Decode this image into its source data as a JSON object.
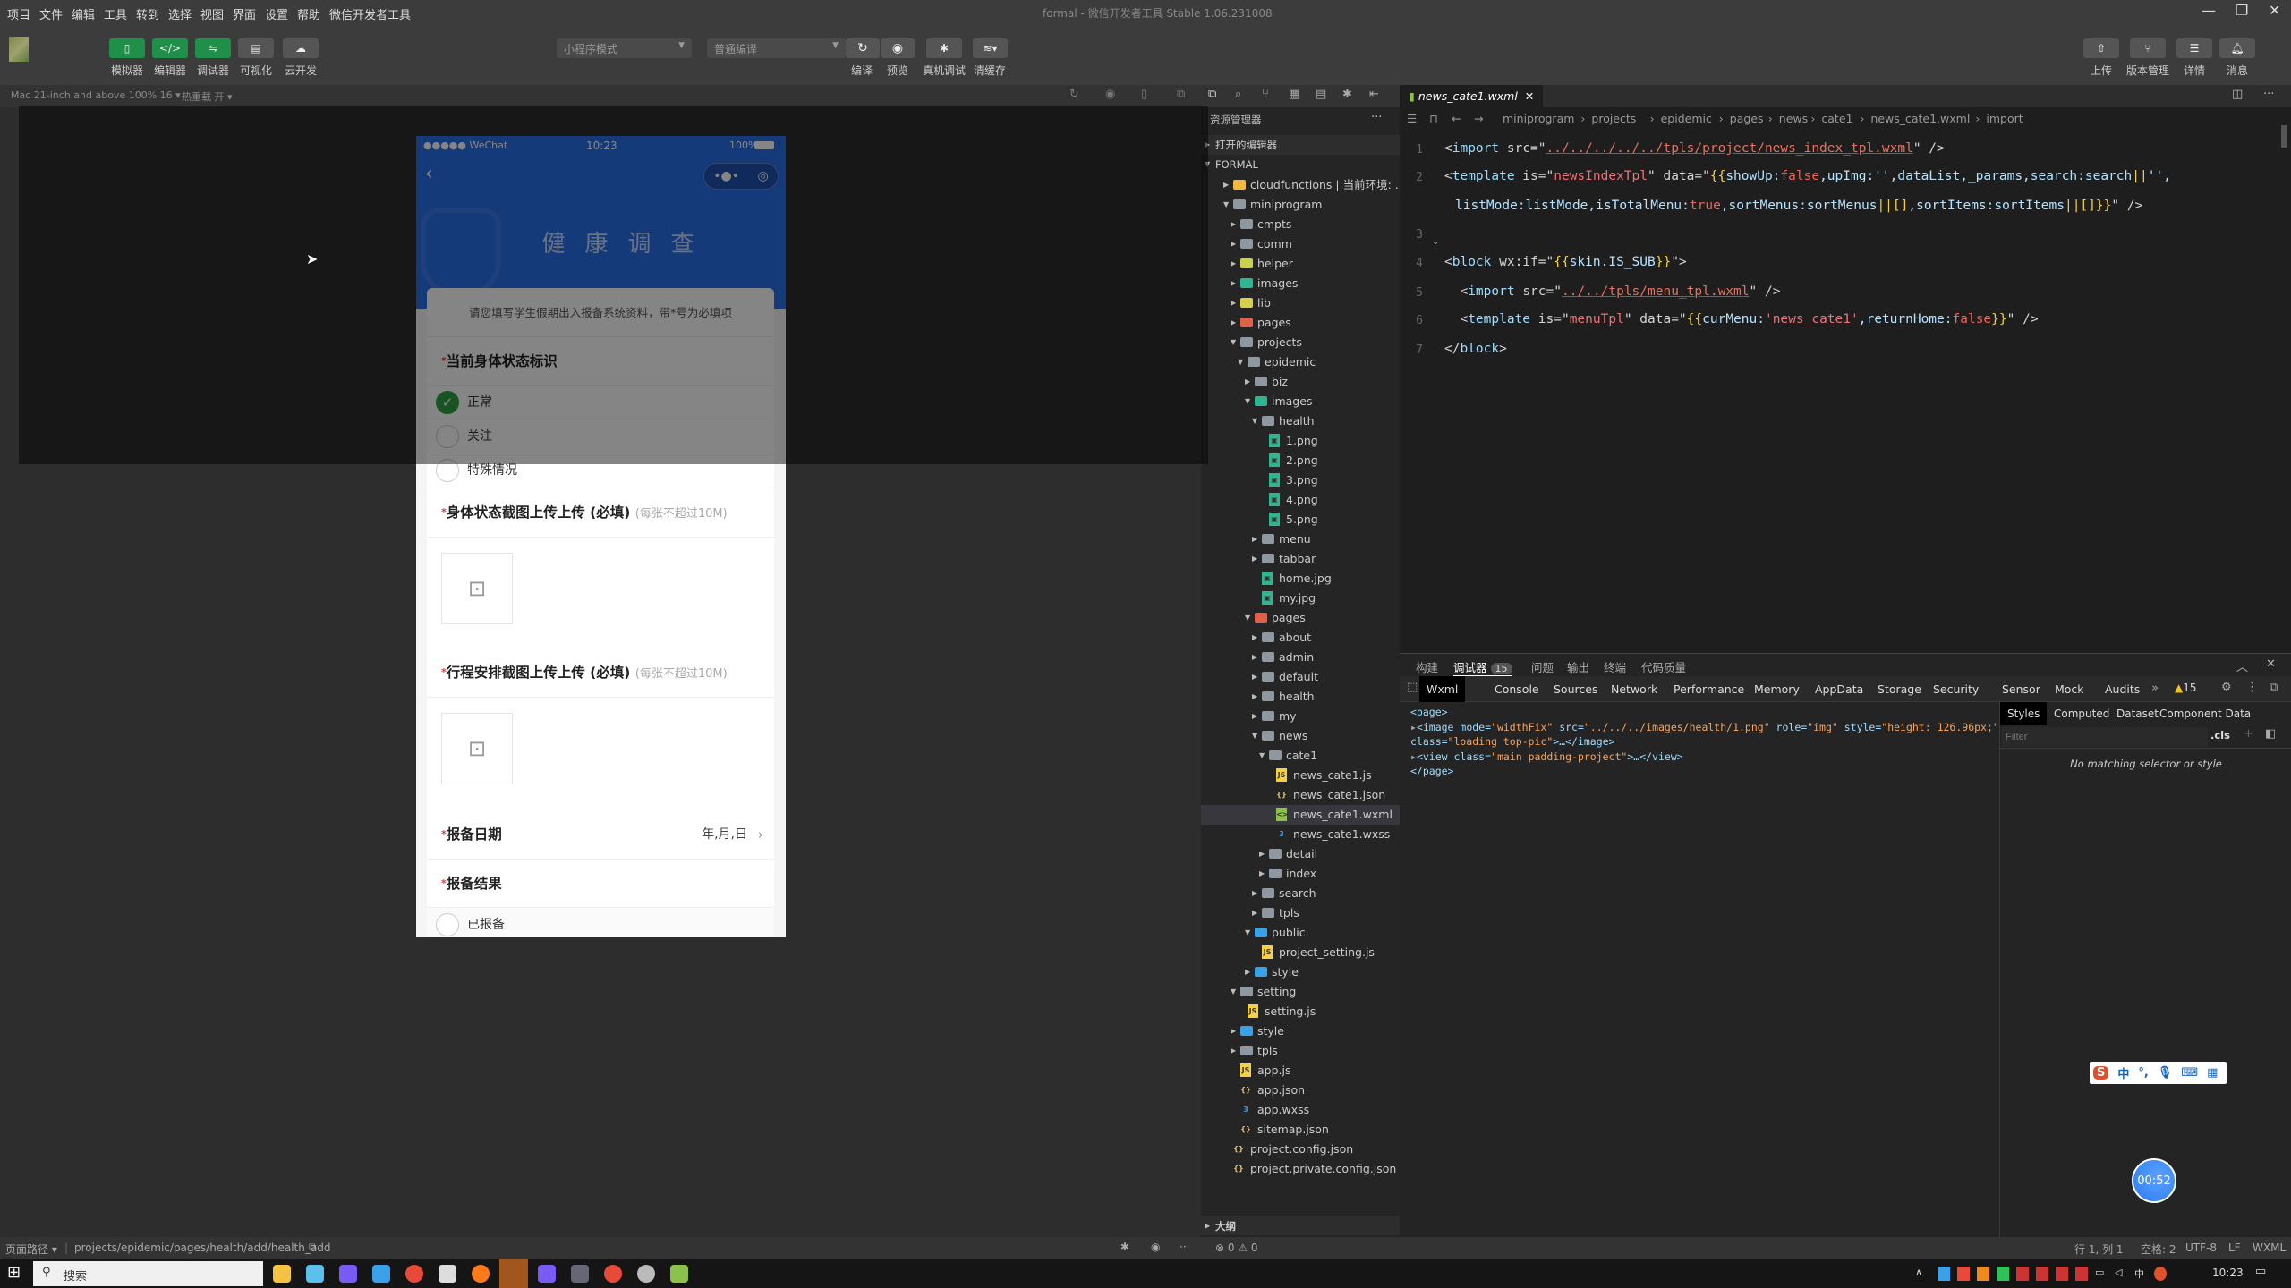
{
  "window": {
    "title": "formal - 微信开发者工具 Stable 1.06.231008",
    "menu": [
      "项目",
      "文件",
      "编辑",
      "工具",
      "转到",
      "选择",
      "视图",
      "界面",
      "设置",
      "帮助",
      "微信开发者工具"
    ]
  },
  "toolbar": {
    "left_buttons": [
      "模拟器",
      "编辑器",
      "调试器",
      "可视化",
      "云开发"
    ],
    "mode_select": "小程序模式",
    "compile_select": "普通编译",
    "actions": [
      "编译",
      "预览",
      "真机调试",
      "清缓存"
    ],
    "right_buttons": [
      "上传",
      "版本管理",
      "详情",
      "消息"
    ]
  },
  "simulator": {
    "device": "Mac 21-inch and above 100% 16 ▾",
    "hot_reload": "热重载 开 ▾",
    "phone": {
      "carrier": "●●●●● WeChat",
      "time": "10:23",
      "battery": "100%",
      "title": "健康调查",
      "intro": "请您填写学生假期出入报备系统资料，带*号为必填项",
      "q1": "当前身体状态标识",
      "options": [
        "正常",
        "关注",
        "特殊情况"
      ],
      "selected_option": "正常",
      "q2": "身体状态截图上传上传 (必填)",
      "q3": "行程安排截图上传上传 (必填)",
      "upload_hint": "(每张不超过10M)",
      "q4": "报备日期",
      "date_placeholder": "年,月,日",
      "q5": "报备结果",
      "result_option": "已报备",
      "required_mark": "*"
    }
  },
  "explorer": {
    "title": "资源管理器",
    "more": "···",
    "open_editors": "打开的编辑器",
    "root": "FORMAL",
    "outline": "大纲",
    "tree": [
      {
        "label": "cloudfunctions | 当前环境: ...",
        "depth": 1,
        "kind": "folder-cloud",
        "open": false
      },
      {
        "label": "miniprogram",
        "depth": 1,
        "kind": "folder",
        "open": true
      },
      {
        "label": "cmpts",
        "depth": 2,
        "kind": "folder",
        "open": false
      },
      {
        "label": "comm",
        "depth": 2,
        "kind": "folder",
        "open": false
      },
      {
        "label": "helper",
        "depth": 2,
        "kind": "folder-helper",
        "open": false
      },
      {
        "label": "images",
        "depth": 2,
        "kind": "folder-images",
        "open": false
      },
      {
        "label": "lib",
        "depth": 2,
        "kind": "folder-lib",
        "open": false
      },
      {
        "label": "pages",
        "depth": 2,
        "kind": "folder-pages",
        "open": false
      },
      {
        "label": "projects",
        "depth": 2,
        "kind": "folder",
        "open": true
      },
      {
        "label": "epidemic",
        "depth": 3,
        "kind": "folder",
        "open": true
      },
      {
        "label": "biz",
        "depth": 4,
        "kind": "folder",
        "open": false
      },
      {
        "label": "images",
        "depth": 4,
        "kind": "folder-images",
        "open": true
      },
      {
        "label": "health",
        "depth": 5,
        "kind": "folder",
        "open": true
      },
      {
        "label": "1.png",
        "depth": 6,
        "kind": "image"
      },
      {
        "label": "2.png",
        "depth": 6,
        "kind": "image"
      },
      {
        "label": "3.png",
        "depth": 6,
        "kind": "image"
      },
      {
        "label": "4.png",
        "depth": 6,
        "kind": "image"
      },
      {
        "label": "5.png",
        "depth": 6,
        "kind": "image"
      },
      {
        "label": "menu",
        "depth": 5,
        "kind": "folder",
        "open": false
      },
      {
        "label": "tabbar",
        "depth": 5,
        "kind": "folder",
        "open": false
      },
      {
        "label": "home.jpg",
        "depth": 5,
        "kind": "image"
      },
      {
        "label": "my.jpg",
        "depth": 5,
        "kind": "image"
      },
      {
        "label": "pages",
        "depth": 4,
        "kind": "folder-pages",
        "open": true
      },
      {
        "label": "about",
        "depth": 5,
        "kind": "folder",
        "open": false
      },
      {
        "label": "admin",
        "depth": 5,
        "kind": "folder",
        "open": false
      },
      {
        "label": "default",
        "depth": 5,
        "kind": "folder",
        "open": false
      },
      {
        "label": "health",
        "depth": 5,
        "kind": "folder",
        "open": false
      },
      {
        "label": "my",
        "depth": 5,
        "kind": "folder",
        "open": false
      },
      {
        "label": "news",
        "depth": 5,
        "kind": "folder",
        "open": true
      },
      {
        "label": "cate1",
        "depth": 6,
        "kind": "folder",
        "open": true
      },
      {
        "label": "news_cate1.js",
        "depth": 7,
        "kind": "js"
      },
      {
        "label": "news_cate1.json",
        "depth": 7,
        "kind": "json"
      },
      {
        "label": "news_cate1.wxml",
        "depth": 7,
        "kind": "wxml",
        "selected": true
      },
      {
        "label": "news_cate1.wxss",
        "depth": 7,
        "kind": "wxss"
      },
      {
        "label": "detail",
        "depth": 6,
        "kind": "folder",
        "open": false
      },
      {
        "label": "index",
        "depth": 6,
        "kind": "folder",
        "open": false
      },
      {
        "label": "search",
        "depth": 5,
        "kind": "folder",
        "open": false
      },
      {
        "label": "tpls",
        "depth": 5,
        "kind": "folder",
        "open": false
      },
      {
        "label": "public",
        "depth": 4,
        "kind": "folder-public",
        "open": true
      },
      {
        "label": "project_setting.js",
        "depth": 5,
        "kind": "js"
      },
      {
        "label": "style",
        "depth": 4,
        "kind": "folder-style",
        "open": false
      },
      {
        "label": "setting",
        "depth": 2,
        "kind": "folder",
        "open": true
      },
      {
        "label": "setting.js",
        "depth": 3,
        "kind": "js"
      },
      {
        "label": "style",
        "depth": 2,
        "kind": "folder-style",
        "open": false
      },
      {
        "label": "tpls",
        "depth": 2,
        "kind": "folder",
        "open": false
      },
      {
        "label": "app.js",
        "depth": 2,
        "kind": "js"
      },
      {
        "label": "app.json",
        "depth": 2,
        "kind": "json"
      },
      {
        "label": "app.wxss",
        "depth": 2,
        "kind": "wxss"
      },
      {
        "label": "sitemap.json",
        "depth": 2,
        "kind": "json"
      },
      {
        "label": "project.config.json",
        "depth": 1,
        "kind": "json"
      },
      {
        "label": "project.private.config.json",
        "depth": 1,
        "kind": "json"
      }
    ]
  },
  "editor": {
    "tab": "news_cate1.wxml",
    "breadcrumb": [
      "miniprogram",
      "projects",
      "epidemic",
      "pages",
      "news",
      "cate1",
      "news_cate1.wxml",
      "import"
    ],
    "line_numbers": [
      "1",
      "2",
      "",
      "3",
      "4",
      "5",
      "6",
      "7"
    ],
    "lines": [
      [
        {
          "c": "p",
          "t": "<"
        },
        {
          "c": "tag",
          "t": "import"
        },
        {
          "c": "p",
          "t": " src=\""
        },
        {
          "c": "link",
          "t": "../../../../../tpls/project/news_index_tpl.wxml"
        },
        {
          "c": "p",
          "t": "\" />"
        }
      ],
      [
        {
          "c": "p",
          "t": "<"
        },
        {
          "c": "tag",
          "t": "template"
        },
        {
          "c": "p",
          "t": " is=\""
        },
        {
          "c": "str",
          "t": "newsIndexTpl"
        },
        {
          "c": "p",
          "t": "\" data=\""
        },
        {
          "c": "br",
          "t": "{{"
        },
        {
          "c": "k",
          "t": "showUp:"
        },
        {
          "c": "bool",
          "t": "false"
        },
        {
          "c": "k",
          "t": ",upImg:'',dataList,_params,search:search"
        },
        {
          "c": "br",
          "t": "||"
        },
        {
          "c": "k",
          "t": "'',"
        }
      ],
      [
        {
          "c": "k",
          "t": "listMode:listMode,isTotalMenu:"
        },
        {
          "c": "bool",
          "t": "true"
        },
        {
          "c": "k",
          "t": ",sortMenus:sortMenus"
        },
        {
          "c": "br",
          "t": "||[]"
        },
        {
          "c": "k",
          "t": ",sortItems:sortItems"
        },
        {
          "c": "br",
          "t": "||[]}}"
        },
        {
          "c": "p",
          "t": "\" />"
        }
      ],
      [],
      [
        {
          "c": "p",
          "t": "<"
        },
        {
          "c": "tag",
          "t": "block"
        },
        {
          "c": "p",
          "t": " wx:if=\""
        },
        {
          "c": "br",
          "t": "{{"
        },
        {
          "c": "k",
          "t": "skin.IS_SUB"
        },
        {
          "c": "br",
          "t": "}}"
        },
        {
          "c": "p",
          "t": "\">"
        }
      ],
      [
        {
          "c": "p",
          "t": "  <"
        },
        {
          "c": "tag",
          "t": "import"
        },
        {
          "c": "p",
          "t": " src=\""
        },
        {
          "c": "link",
          "t": "../../tpls/menu_tpl.wxml"
        },
        {
          "c": "p",
          "t": "\" />"
        }
      ],
      [
        {
          "c": "p",
          "t": "  <"
        },
        {
          "c": "tag",
          "t": "template"
        },
        {
          "c": "p",
          "t": " is=\""
        },
        {
          "c": "str",
          "t": "menuTpl"
        },
        {
          "c": "p",
          "t": "\" data=\""
        },
        {
          "c": "br",
          "t": "{{"
        },
        {
          "c": "k",
          "t": "curMenu:"
        },
        {
          "c": "str",
          "t": "'news_cate1'"
        },
        {
          "c": "k",
          "t": ",returnHome:"
        },
        {
          "c": "bool",
          "t": "false"
        },
        {
          "c": "br",
          "t": "}}"
        },
        {
          "c": "p",
          "t": "\" />"
        }
      ],
      [
        {
          "c": "p",
          "t": "</"
        },
        {
          "c": "tag",
          "t": "block"
        },
        {
          "c": "p",
          "t": ">"
        }
      ]
    ]
  },
  "debugger": {
    "tabs": [
      "构建",
      "调试器",
      "问题",
      "输出",
      "终端",
      "代码质量"
    ],
    "debugger_badge": "15",
    "devtools_tabs": [
      "Wxml",
      "Console",
      "Sources",
      "Network",
      "Performance",
      "Memory",
      "AppData",
      "Storage",
      "Security",
      "Sensor",
      "Mock",
      "Audits"
    ],
    "more": "»",
    "warnings": "15",
    "wxml_lines": [
      [
        {
          "c": "a",
          "t": "<page>"
        }
      ],
      [
        {
          "c": "g",
          "t": "▸"
        },
        {
          "c": "a",
          "t": "<image mode="
        },
        {
          "c": "v",
          "t": "\"widthFix\""
        },
        {
          "c": "a",
          "t": " src="
        },
        {
          "c": "v",
          "t": "\"../../../images/health/1.png\""
        },
        {
          "c": "a",
          "t": " role="
        },
        {
          "c": "v",
          "t": "\"img\""
        },
        {
          "c": "a",
          "t": " style="
        },
        {
          "c": "v",
          "t": "\"height: 126.96px;\""
        }
      ],
      [
        {
          "c": "a",
          "t": "class="
        },
        {
          "c": "v",
          "t": "\"loading top-pic\""
        },
        {
          "c": "a",
          "t": ">…</image>"
        }
      ],
      [
        {
          "c": "g",
          "t": "▸"
        },
        {
          "c": "a",
          "t": "<view class="
        },
        {
          "c": "v",
          "t": "\"main padding-project\""
        },
        {
          "c": "a",
          "t": ">…</view>"
        }
      ],
      [
        {
          "c": "a",
          "t": "</page>"
        }
      ]
    ],
    "style_tabs": [
      "Styles",
      "Computed",
      "Dataset",
      "Component Data"
    ],
    "filter_placeholder": "Filter",
    "cls": ".cls",
    "no_match": "No matching selector or style"
  },
  "statusbar": {
    "page_path_label": "页面路径 ▾",
    "page_path": "projects/epidemic/pages/health/add/health_add",
    "problems": "⊗ 0 ⚠ 0",
    "position": "行 1, 列 1",
    "indent": "空格: 2",
    "encoding": "UTF-8",
    "eol": "LF",
    "language": "WXML"
  },
  "ime": {
    "lang": "中",
    "punct": "°,"
  },
  "timer": "00:52",
  "taskbar": {
    "search_placeholder": "搜索",
    "clock": "10:23"
  }
}
